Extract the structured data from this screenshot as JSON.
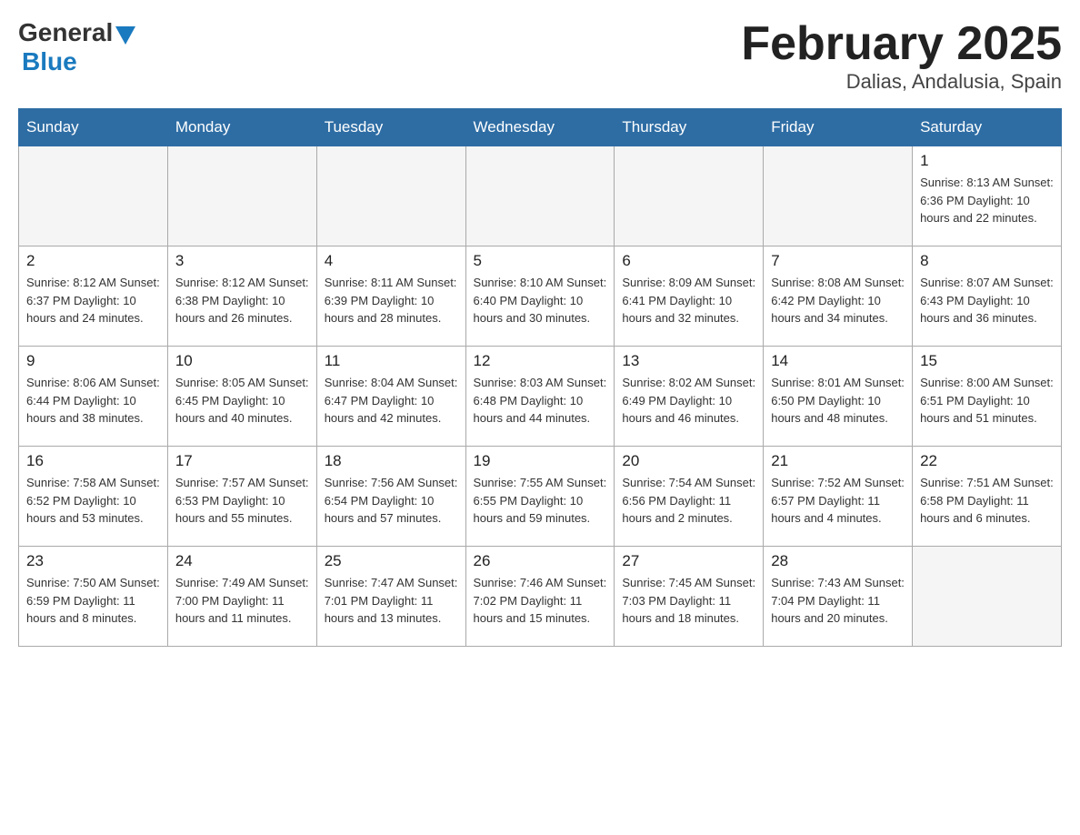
{
  "header": {
    "logo_general": "General",
    "logo_blue": "Blue",
    "month_title": "February 2025",
    "location": "Dalias, Andalusia, Spain"
  },
  "days_of_week": [
    "Sunday",
    "Monday",
    "Tuesday",
    "Wednesday",
    "Thursday",
    "Friday",
    "Saturday"
  ],
  "weeks": [
    [
      {
        "day": "",
        "info": ""
      },
      {
        "day": "",
        "info": ""
      },
      {
        "day": "",
        "info": ""
      },
      {
        "day": "",
        "info": ""
      },
      {
        "day": "",
        "info": ""
      },
      {
        "day": "",
        "info": ""
      },
      {
        "day": "1",
        "info": "Sunrise: 8:13 AM\nSunset: 6:36 PM\nDaylight: 10 hours and 22 minutes."
      }
    ],
    [
      {
        "day": "2",
        "info": "Sunrise: 8:12 AM\nSunset: 6:37 PM\nDaylight: 10 hours and 24 minutes."
      },
      {
        "day": "3",
        "info": "Sunrise: 8:12 AM\nSunset: 6:38 PM\nDaylight: 10 hours and 26 minutes."
      },
      {
        "day": "4",
        "info": "Sunrise: 8:11 AM\nSunset: 6:39 PM\nDaylight: 10 hours and 28 minutes."
      },
      {
        "day": "5",
        "info": "Sunrise: 8:10 AM\nSunset: 6:40 PM\nDaylight: 10 hours and 30 minutes."
      },
      {
        "day": "6",
        "info": "Sunrise: 8:09 AM\nSunset: 6:41 PM\nDaylight: 10 hours and 32 minutes."
      },
      {
        "day": "7",
        "info": "Sunrise: 8:08 AM\nSunset: 6:42 PM\nDaylight: 10 hours and 34 minutes."
      },
      {
        "day": "8",
        "info": "Sunrise: 8:07 AM\nSunset: 6:43 PM\nDaylight: 10 hours and 36 minutes."
      }
    ],
    [
      {
        "day": "9",
        "info": "Sunrise: 8:06 AM\nSunset: 6:44 PM\nDaylight: 10 hours and 38 minutes."
      },
      {
        "day": "10",
        "info": "Sunrise: 8:05 AM\nSunset: 6:45 PM\nDaylight: 10 hours and 40 minutes."
      },
      {
        "day": "11",
        "info": "Sunrise: 8:04 AM\nSunset: 6:47 PM\nDaylight: 10 hours and 42 minutes."
      },
      {
        "day": "12",
        "info": "Sunrise: 8:03 AM\nSunset: 6:48 PM\nDaylight: 10 hours and 44 minutes."
      },
      {
        "day": "13",
        "info": "Sunrise: 8:02 AM\nSunset: 6:49 PM\nDaylight: 10 hours and 46 minutes."
      },
      {
        "day": "14",
        "info": "Sunrise: 8:01 AM\nSunset: 6:50 PM\nDaylight: 10 hours and 48 minutes."
      },
      {
        "day": "15",
        "info": "Sunrise: 8:00 AM\nSunset: 6:51 PM\nDaylight: 10 hours and 51 minutes."
      }
    ],
    [
      {
        "day": "16",
        "info": "Sunrise: 7:58 AM\nSunset: 6:52 PM\nDaylight: 10 hours and 53 minutes."
      },
      {
        "day": "17",
        "info": "Sunrise: 7:57 AM\nSunset: 6:53 PM\nDaylight: 10 hours and 55 minutes."
      },
      {
        "day": "18",
        "info": "Sunrise: 7:56 AM\nSunset: 6:54 PM\nDaylight: 10 hours and 57 minutes."
      },
      {
        "day": "19",
        "info": "Sunrise: 7:55 AM\nSunset: 6:55 PM\nDaylight: 10 hours and 59 minutes."
      },
      {
        "day": "20",
        "info": "Sunrise: 7:54 AM\nSunset: 6:56 PM\nDaylight: 11 hours and 2 minutes."
      },
      {
        "day": "21",
        "info": "Sunrise: 7:52 AM\nSunset: 6:57 PM\nDaylight: 11 hours and 4 minutes."
      },
      {
        "day": "22",
        "info": "Sunrise: 7:51 AM\nSunset: 6:58 PM\nDaylight: 11 hours and 6 minutes."
      }
    ],
    [
      {
        "day": "23",
        "info": "Sunrise: 7:50 AM\nSunset: 6:59 PM\nDaylight: 11 hours and 8 minutes."
      },
      {
        "day": "24",
        "info": "Sunrise: 7:49 AM\nSunset: 7:00 PM\nDaylight: 11 hours and 11 minutes."
      },
      {
        "day": "25",
        "info": "Sunrise: 7:47 AM\nSunset: 7:01 PM\nDaylight: 11 hours and 13 minutes."
      },
      {
        "day": "26",
        "info": "Sunrise: 7:46 AM\nSunset: 7:02 PM\nDaylight: 11 hours and 15 minutes."
      },
      {
        "day": "27",
        "info": "Sunrise: 7:45 AM\nSunset: 7:03 PM\nDaylight: 11 hours and 18 minutes."
      },
      {
        "day": "28",
        "info": "Sunrise: 7:43 AM\nSunset: 7:04 PM\nDaylight: 11 hours and 20 minutes."
      },
      {
        "day": "",
        "info": ""
      }
    ]
  ]
}
